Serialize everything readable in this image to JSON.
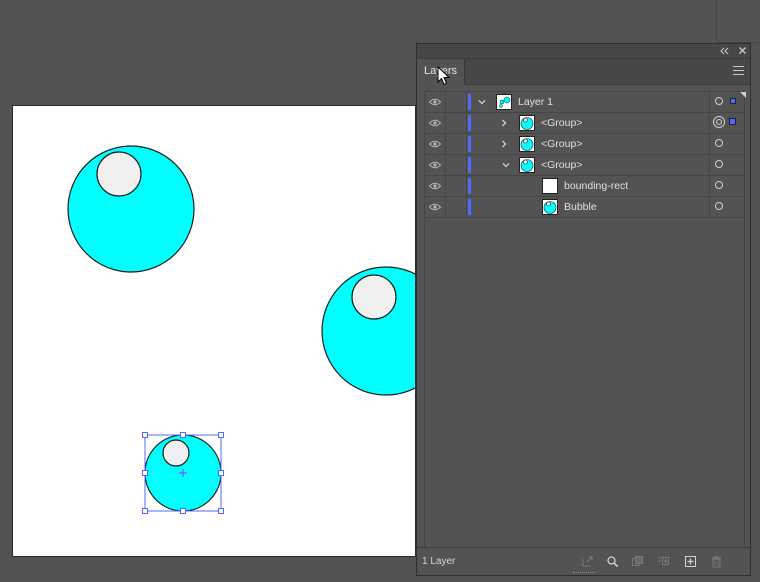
{
  "panel": {
    "collapse_icon": "double-chevron-left-icon",
    "close_icon": "close-icon",
    "tab_label": "Layers",
    "menu_icon": "hamburger-menu-icon",
    "accent_color": "#4f6bff",
    "footer": {
      "layer_count": "1 Layer",
      "buttons": [
        {
          "name": "export-icon"
        },
        {
          "name": "search-icon"
        },
        {
          "name": "clipping-mask-icon"
        },
        {
          "name": "new-sublayer-icon"
        },
        {
          "name": "new-layer-icon"
        },
        {
          "name": "trash-icon"
        }
      ]
    }
  },
  "layers": [
    {
      "label": "Layer 1",
      "depth": 0,
      "expanded": true
    },
    {
      "label": "<Group>",
      "depth": 1,
      "expanded": false
    },
    {
      "label": "<Group>",
      "depth": 1,
      "expanded": false
    },
    {
      "label": "<Group>",
      "depth": 1,
      "expanded": true
    },
    {
      "label": "bounding-rect",
      "depth": 2
    },
    {
      "label": "Bubble",
      "depth": 2
    }
  ],
  "artboard": {
    "background": "#ffffff",
    "bubble_fill": "#00ffff",
    "highlight_fill": "#f0f0f0"
  }
}
